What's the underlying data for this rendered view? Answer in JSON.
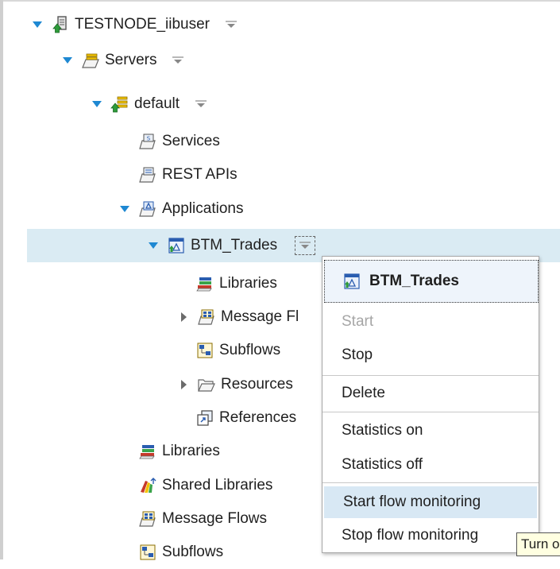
{
  "tree": {
    "node": {
      "label": "TESTNODE_iibuser"
    },
    "servers": {
      "label": "Servers"
    },
    "default_server": {
      "label": "default"
    },
    "services": {
      "label": "Services"
    },
    "rest_apis": {
      "label": "REST APIs"
    },
    "applications": {
      "label": "Applications"
    },
    "btm_trades": {
      "label": "BTM_Trades"
    },
    "app_libraries": {
      "label": "Libraries"
    },
    "app_message_flows": {
      "label": "Message Fl"
    },
    "app_subflows": {
      "label": "Subflows"
    },
    "app_resources": {
      "label": "Resources"
    },
    "app_references": {
      "label": "References"
    },
    "libraries": {
      "label": "Libraries"
    },
    "shared_libraries": {
      "label": "Shared Libraries"
    },
    "message_flows": {
      "label": "Message Flows"
    },
    "subflows": {
      "label": "Subflows"
    }
  },
  "context_menu": {
    "title": "BTM_Trades",
    "items": {
      "start": "Start",
      "stop": "Stop",
      "delete": "Delete",
      "statistics_on": "Statistics on",
      "statistics_off": "Statistics off",
      "start_flow_monitoring": "Start flow monitoring",
      "stop_flow_monitoring": "Stop flow monitoring"
    }
  },
  "tooltip": {
    "text": "Turn on flow monitoring"
  },
  "colors": {
    "selection": "#daebf3",
    "menu_hover": "#d8e8f4",
    "twisty": "#1e88d2",
    "disabled_text": "#a6a6a6"
  }
}
